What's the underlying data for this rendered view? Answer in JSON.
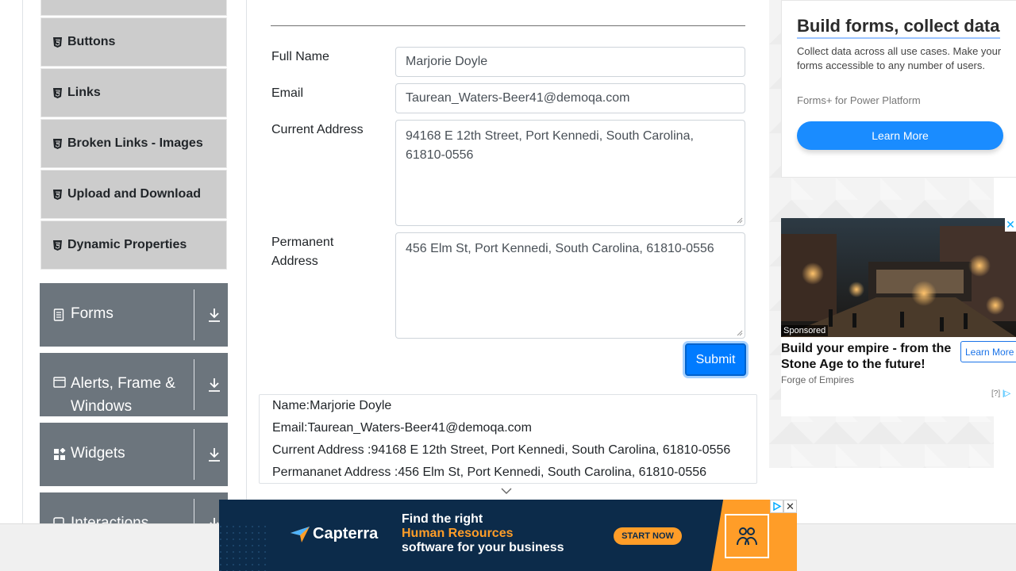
{
  "sidebar": {
    "elements_items": [
      {
        "label": "Buttons"
      },
      {
        "label": "Links"
      },
      {
        "label": "Broken Links - Images"
      },
      {
        "label": "Upload and Download"
      },
      {
        "label": "Dynamic Properties"
      }
    ],
    "groups": [
      {
        "label": "Forms",
        "icon": "document-icon"
      },
      {
        "label": "Alerts, Frame & Windows",
        "icon": "window-icon"
      },
      {
        "label": "Widgets",
        "icon": "widgets-icon"
      },
      {
        "label": "Interactions",
        "icon": "interactions-icon"
      }
    ]
  },
  "form": {
    "full_name_label": "Full Name",
    "full_name_value": "Marjorie Doyle",
    "email_label": "Email",
    "email_value": "Taurean_Waters-Beer41@demoqa.com",
    "current_address_label": "Current Address",
    "current_address_value": "94168 E 12th Street, Port Kennedi, South Carolina, 61810-0556",
    "permanent_address_label_line1": "Permanent",
    "permanent_address_label_line2": "Address",
    "permanent_address_value": "456 Elm St, Port Kennedi, South Carolina, 61810-0556",
    "submit_label": "Submit"
  },
  "output": {
    "name": "Name:Marjorie Doyle",
    "email": "Email:Taurean_Waters-Beer41@demoqa.com",
    "current_address": "Current Address :94168 E 12th Street, Port Kennedi, South Carolina, 61810-0556",
    "permanent_address": "Permananet Address :456 Elm St, Port Kennedi, South Carolina, 61810-0556"
  },
  "ad_top": {
    "title": "Build forms, collect data",
    "description": "Collect data across all use cases. Make your forms accessible to any number of users.",
    "subtitle": "Forms+ for Power Platform",
    "button": "Learn More"
  },
  "ad_middle": {
    "sponsored": "Sponsored",
    "headline": "Build your empire - from the Stone Age to the future!",
    "button": "Learn More",
    "source": "Forge of Empires",
    "info": "[?]"
  },
  "banner": {
    "brand": "Capterra",
    "line1": "Find the right",
    "line2": "Human Resources",
    "line3": "software for your business",
    "cta": "START NOW"
  },
  "colors": {
    "primary": "#007bff",
    "sidebar_item_bg": "#cccccc",
    "sidebar_group_bg": "#6c757d",
    "banner_bg": "#0c2b4a",
    "banner_accent": "#ff9d28"
  }
}
